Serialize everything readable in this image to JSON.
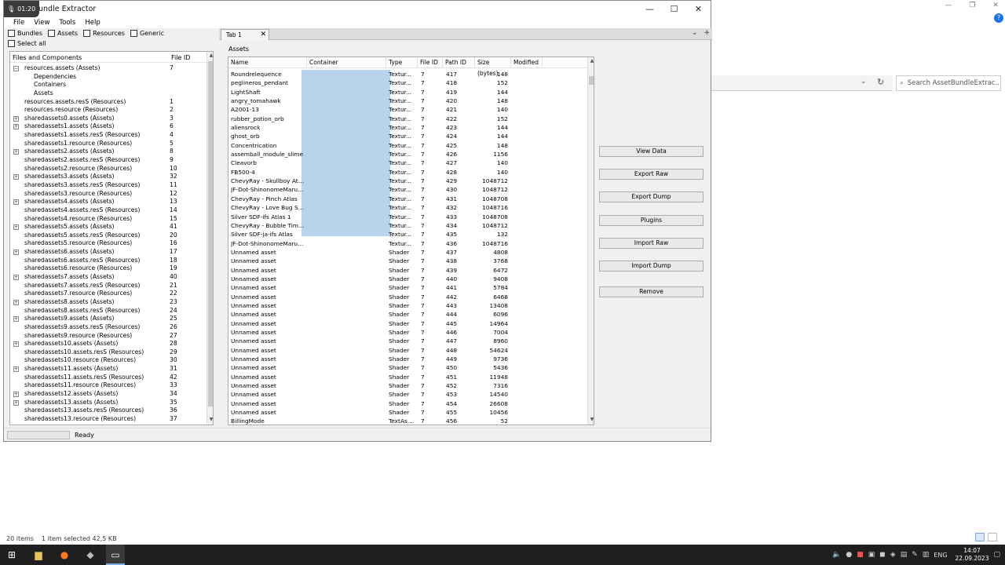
{
  "window": {
    "title": "AssetBundle Extractor",
    "title_visible": "undle Extractor",
    "rec_time": "01:20",
    "controls": [
      "—",
      "☐",
      "✕"
    ]
  },
  "menu": [
    "File",
    "View",
    "Tools",
    "Help"
  ],
  "filters": [
    "Bundles",
    "Assets",
    "Resources",
    "Generic"
  ],
  "select_all": "Select all",
  "tree": {
    "headers": [
      "Files and Components",
      "File ID"
    ],
    "rows": [
      {
        "name": "resources.assets (Assets)",
        "id": "7",
        "level": 0,
        "exp": "minus"
      },
      {
        "name": "Dependencies",
        "id": "",
        "level": 2,
        "exp": ""
      },
      {
        "name": "Containers",
        "id": "",
        "level": 2,
        "exp": ""
      },
      {
        "name": "Assets",
        "id": "",
        "level": 2,
        "exp": ""
      },
      {
        "name": "resources.assets.resS (Resources)",
        "id": "1",
        "level": 0,
        "exp": ""
      },
      {
        "name": "resources.resource (Resources)",
        "id": "2",
        "level": 0,
        "exp": ""
      },
      {
        "name": "sharedassets0.assets (Assets)",
        "id": "3",
        "level": 0,
        "exp": "plus"
      },
      {
        "name": "sharedassets1.assets (Assets)",
        "id": "6",
        "level": 0,
        "exp": "plus"
      },
      {
        "name": "sharedassets1.assets.resS (Resources)",
        "id": "4",
        "level": 0,
        "exp": ""
      },
      {
        "name": "sharedassets1.resource (Resources)",
        "id": "5",
        "level": 0,
        "exp": ""
      },
      {
        "name": "sharedassets2.assets (Assets)",
        "id": "8",
        "level": 0,
        "exp": "plus"
      },
      {
        "name": "sharedassets2.assets.resS (Resources)",
        "id": "9",
        "level": 0,
        "exp": ""
      },
      {
        "name": "sharedassets2.resource (Resources)",
        "id": "10",
        "level": 0,
        "exp": ""
      },
      {
        "name": "sharedassets3.assets (Assets)",
        "id": "32",
        "level": 0,
        "exp": "plus"
      },
      {
        "name": "sharedassets3.assets.resS (Resources)",
        "id": "11",
        "level": 0,
        "exp": ""
      },
      {
        "name": "sharedassets3.resource (Resources)",
        "id": "12",
        "level": 0,
        "exp": ""
      },
      {
        "name": "sharedassets4.assets (Assets)",
        "id": "13",
        "level": 0,
        "exp": "plus"
      },
      {
        "name": "sharedassets4.assets.resS (Resources)",
        "id": "14",
        "level": 0,
        "exp": ""
      },
      {
        "name": "sharedassets4.resource (Resources)",
        "id": "15",
        "level": 0,
        "exp": ""
      },
      {
        "name": "sharedassets5.assets (Assets)",
        "id": "41",
        "level": 0,
        "exp": "plus"
      },
      {
        "name": "sharedassets5.assets.resS (Resources)",
        "id": "20",
        "level": 0,
        "exp": ""
      },
      {
        "name": "sharedassets5.resource (Resources)",
        "id": "16",
        "level": 0,
        "exp": ""
      },
      {
        "name": "sharedassets6.assets (Assets)",
        "id": "17",
        "level": 0,
        "exp": "plus"
      },
      {
        "name": "sharedassets6.assets.resS (Resources)",
        "id": "18",
        "level": 0,
        "exp": ""
      },
      {
        "name": "sharedassets6.resource (Resources)",
        "id": "19",
        "level": 0,
        "exp": ""
      },
      {
        "name": "sharedassets7.assets (Assets)",
        "id": "40",
        "level": 0,
        "exp": "plus"
      },
      {
        "name": "sharedassets7.assets.resS (Resources)",
        "id": "21",
        "level": 0,
        "exp": ""
      },
      {
        "name": "sharedassets7.resource (Resources)",
        "id": "22",
        "level": 0,
        "exp": ""
      },
      {
        "name": "sharedassets8.assets (Assets)",
        "id": "23",
        "level": 0,
        "exp": "plus"
      },
      {
        "name": "sharedassets8.assets.resS (Resources)",
        "id": "24",
        "level": 0,
        "exp": ""
      },
      {
        "name": "sharedassets9.assets (Assets)",
        "id": "25",
        "level": 0,
        "exp": "plus"
      },
      {
        "name": "sharedassets9.assets.resS (Resources)",
        "id": "26",
        "level": 0,
        "exp": ""
      },
      {
        "name": "sharedassets9.resource (Resources)",
        "id": "27",
        "level": 0,
        "exp": ""
      },
      {
        "name": "sharedassets10.assets (Assets)",
        "id": "28",
        "level": 0,
        "exp": "plus"
      },
      {
        "name": "sharedassets10.assets.resS (Resources)",
        "id": "29",
        "level": 0,
        "exp": ""
      },
      {
        "name": "sharedassets10.resource (Resources)",
        "id": "30",
        "level": 0,
        "exp": ""
      },
      {
        "name": "sharedassets11.assets (Assets)",
        "id": "31",
        "level": 0,
        "exp": "plus"
      },
      {
        "name": "sharedassets11.assets.resS (Resources)",
        "id": "42",
        "level": 0,
        "exp": ""
      },
      {
        "name": "sharedassets11.resource (Resources)",
        "id": "33",
        "level": 0,
        "exp": ""
      },
      {
        "name": "sharedassets12.assets (Assets)",
        "id": "34",
        "level": 0,
        "exp": "plus"
      },
      {
        "name": "sharedassets13.assets (Assets)",
        "id": "35",
        "level": 0,
        "exp": "plus"
      },
      {
        "name": "sharedassets13.assets.resS (Resources)",
        "id": "36",
        "level": 0,
        "exp": ""
      },
      {
        "name": "sharedassets13.resource (Resources)",
        "id": "37",
        "level": 0,
        "exp": ""
      }
    ]
  },
  "tabs": [
    {
      "label": "Tab 1",
      "close": "✕"
    }
  ],
  "tab_tools": [
    "⌄",
    "+"
  ],
  "assets_label": "Assets",
  "grid": {
    "headers": [
      "Name",
      "Container",
      "Type",
      "File ID",
      "Path ID",
      "Size (bytes)",
      "Modified"
    ],
    "rows": [
      {
        "name": "Roundrelequence",
        "type": "Textur...",
        "fid": "7",
        "pid": "417",
        "size": "148"
      },
      {
        "name": "peglineros_pendant",
        "type": "Textur...",
        "fid": "7",
        "pid": "418",
        "size": "152"
      },
      {
        "name": "LightShaft",
        "type": "Textur...",
        "fid": "7",
        "pid": "419",
        "size": "144"
      },
      {
        "name": "angry_tomahawk",
        "type": "Textur...",
        "fid": "7",
        "pid": "420",
        "size": "148"
      },
      {
        "name": "A2001-13",
        "type": "Textur...",
        "fid": "7",
        "pid": "421",
        "size": "140"
      },
      {
        "name": "rubber_potion_orb",
        "type": "Textur...",
        "fid": "7",
        "pid": "422",
        "size": "152"
      },
      {
        "name": "aliensrock",
        "type": "Textur...",
        "fid": "7",
        "pid": "423",
        "size": "144"
      },
      {
        "name": "ghost_orb",
        "type": "Textur...",
        "fid": "7",
        "pid": "424",
        "size": "144"
      },
      {
        "name": "Concentrication",
        "type": "Textur...",
        "fid": "7",
        "pid": "425",
        "size": "148"
      },
      {
        "name": "assemball_module_slime",
        "type": "Textur...",
        "fid": "7",
        "pid": "426",
        "size": "1156"
      },
      {
        "name": "Cleavorb",
        "type": "Textur...",
        "fid": "7",
        "pid": "427",
        "size": "140"
      },
      {
        "name": "FB500-4",
        "type": "Textur...",
        "fid": "7",
        "pid": "428",
        "size": "140"
      },
      {
        "name": "ChevyRay - Skullboy Atlas",
        "type": "Textur...",
        "fid": "7",
        "pid": "429",
        "size": "1048712"
      },
      {
        "name": "JF-Dot-ShinonomeMaru12 ...",
        "type": "Textur...",
        "fid": "7",
        "pid": "430",
        "size": "1048712"
      },
      {
        "name": "ChevyRay - Pinch Atlas",
        "type": "Textur...",
        "fid": "7",
        "pid": "431",
        "size": "1048708"
      },
      {
        "name": "ChevyRay - Love Bug SDF ...",
        "type": "Textur...",
        "fid": "7",
        "pid": "432",
        "size": "1048716"
      },
      {
        "name": "Silver SDF-ifs Atlas 1",
        "type": "Textur...",
        "fid": "7",
        "pid": "433",
        "size": "1048708"
      },
      {
        "name": "ChevyRay - Bubble Time A...",
        "type": "Textur...",
        "fid": "7",
        "pid": "434",
        "size": "1048712"
      },
      {
        "name": "Silver SDF-ja-ifs Atlas",
        "type": "Textur...",
        "fid": "7",
        "pid": "435",
        "size": "132"
      },
      {
        "name": "JF-Dot-ShinonomeMaru12 ...",
        "type": "Textur...",
        "fid": "7",
        "pid": "436",
        "size": "1048716"
      },
      {
        "name": "Unnamed asset",
        "type": "Shader",
        "fid": "7",
        "pid": "437",
        "size": "4808"
      },
      {
        "name": "Unnamed asset",
        "type": "Shader",
        "fid": "7",
        "pid": "438",
        "size": "3768"
      },
      {
        "name": "Unnamed asset",
        "type": "Shader",
        "fid": "7",
        "pid": "439",
        "size": "6472"
      },
      {
        "name": "Unnamed asset",
        "type": "Shader",
        "fid": "7",
        "pid": "440",
        "size": "9408"
      },
      {
        "name": "Unnamed asset",
        "type": "Shader",
        "fid": "7",
        "pid": "441",
        "size": "5784"
      },
      {
        "name": "Unnamed asset",
        "type": "Shader",
        "fid": "7",
        "pid": "442",
        "size": "6468"
      },
      {
        "name": "Unnamed asset",
        "type": "Shader",
        "fid": "7",
        "pid": "443",
        "size": "13408"
      },
      {
        "name": "Unnamed asset",
        "type": "Shader",
        "fid": "7",
        "pid": "444",
        "size": "6096"
      },
      {
        "name": "Unnamed asset",
        "type": "Shader",
        "fid": "7",
        "pid": "445",
        "size": "14964"
      },
      {
        "name": "Unnamed asset",
        "type": "Shader",
        "fid": "7",
        "pid": "446",
        "size": "7004"
      },
      {
        "name": "Unnamed asset",
        "type": "Shader",
        "fid": "7",
        "pid": "447",
        "size": "8960"
      },
      {
        "name": "Unnamed asset",
        "type": "Shader",
        "fid": "7",
        "pid": "448",
        "size": "54624"
      },
      {
        "name": "Unnamed asset",
        "type": "Shader",
        "fid": "7",
        "pid": "449",
        "size": "9736"
      },
      {
        "name": "Unnamed asset",
        "type": "Shader",
        "fid": "7",
        "pid": "450",
        "size": "5436"
      },
      {
        "name": "Unnamed asset",
        "type": "Shader",
        "fid": "7",
        "pid": "451",
        "size": "11948"
      },
      {
        "name": "Unnamed asset",
        "type": "Shader",
        "fid": "7",
        "pid": "452",
        "size": "7316"
      },
      {
        "name": "Unnamed asset",
        "type": "Shader",
        "fid": "7",
        "pid": "453",
        "size": "14540"
      },
      {
        "name": "Unnamed asset",
        "type": "Shader",
        "fid": "7",
        "pid": "454",
        "size": "26608"
      },
      {
        "name": "Unnamed asset",
        "type": "Shader",
        "fid": "7",
        "pid": "455",
        "size": "10456"
      },
      {
        "name": "BillingMode",
        "type": "TextAs...",
        "fid": "7",
        "pid": "456",
        "size": "52"
      }
    ]
  },
  "buttons": [
    "View Data",
    "Export Raw",
    "Export Dump",
    "Plugins",
    "Import Raw",
    "Import Dump",
    "Remove"
  ],
  "status": {
    "text": "Ready"
  },
  "explorer": {
    "search_placeholder": "Search AssetBundleExtrac...",
    "items_count": "20 items",
    "selection": "1 item selected  42,5 KB"
  },
  "taskbar": {
    "lang": "ENG",
    "time": "14:07",
    "date": "22.09.2023"
  },
  "colors": {
    "selection": "#b9d3ec",
    "taskbar": "#1f1f1f"
  }
}
